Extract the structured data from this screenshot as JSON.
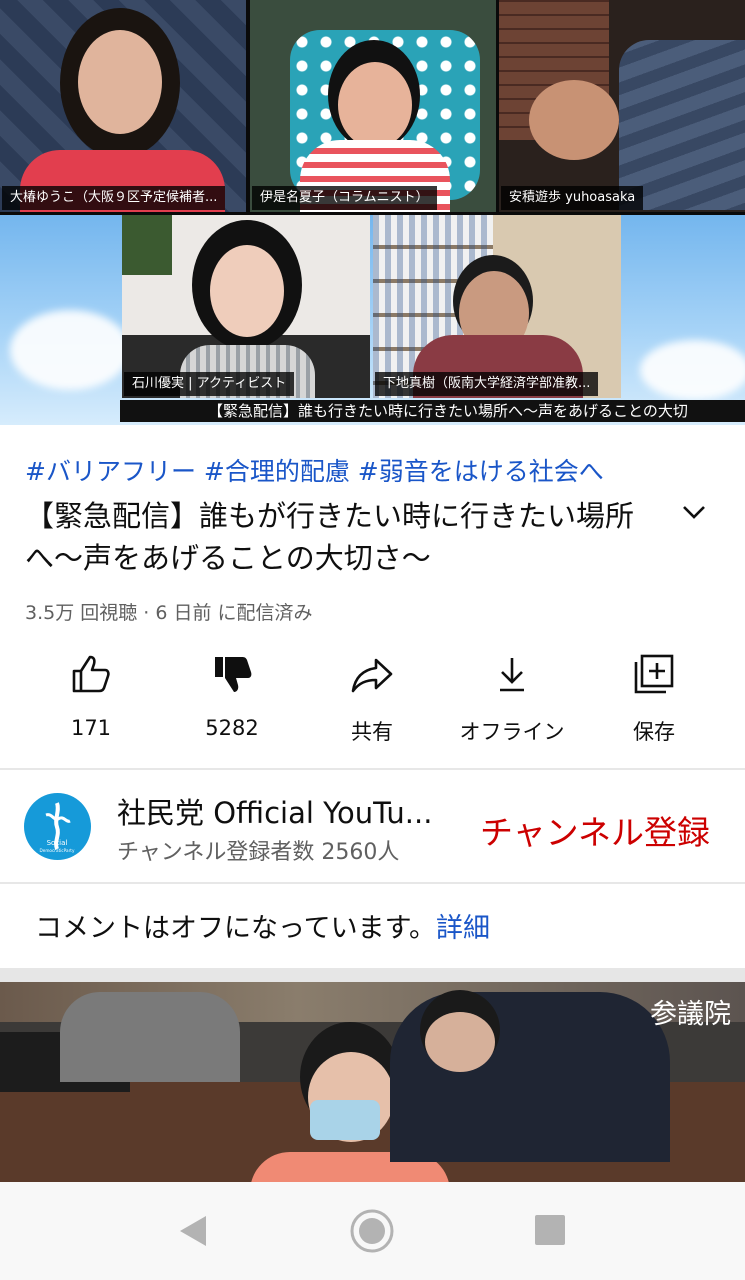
{
  "video": {
    "participants": [
      {
        "name": "大椿ゆうこ（大阪９区予定候補者..."
      },
      {
        "name": "伊是名夏子（コラムニスト）"
      },
      {
        "name": "安積遊歩 yuhoasaka"
      },
      {
        "name": "石川優実 | アクティビスト"
      },
      {
        "name": "下地真樹（阪南大学経済学部准教..."
      }
    ],
    "ticker": "【緊急配信】誰も行きたい時に行きたい場所へ〜声をあげることの大切"
  },
  "meta": {
    "hashtags": "#バリアフリー #合理的配慮 #弱音をはける社会へ",
    "title": "【緊急配信】誰もが行きたい時に行きたい場所へ〜声をあげることの大切さ〜",
    "stats": "3.5万 回視聴 · 6 日前 に配信済み"
  },
  "actions": [
    {
      "label": "171",
      "icon": "thumbs-up-icon"
    },
    {
      "label": "5282",
      "icon": "thumbs-down-icon"
    },
    {
      "label": "共有",
      "icon": "share-icon"
    },
    {
      "label": "オフライン",
      "icon": "download-icon"
    },
    {
      "label": "保存",
      "icon": "save-playlist-icon"
    }
  ],
  "channel": {
    "name": "社民党 Official YouTu...",
    "subscribers": "チャンネル登録者数 2560人",
    "subscribe_label": "チャンネル登録",
    "avatar_text": "Social Democratic Party"
  },
  "comments": {
    "text": "コメントはオフになっています。",
    "link": "詳細"
  },
  "next_video": {
    "watermark": "参議院"
  },
  "colors": {
    "accent_link": "#1a56c8",
    "subscribe": "#cc0000",
    "channel_avatar": "#169ad9"
  }
}
